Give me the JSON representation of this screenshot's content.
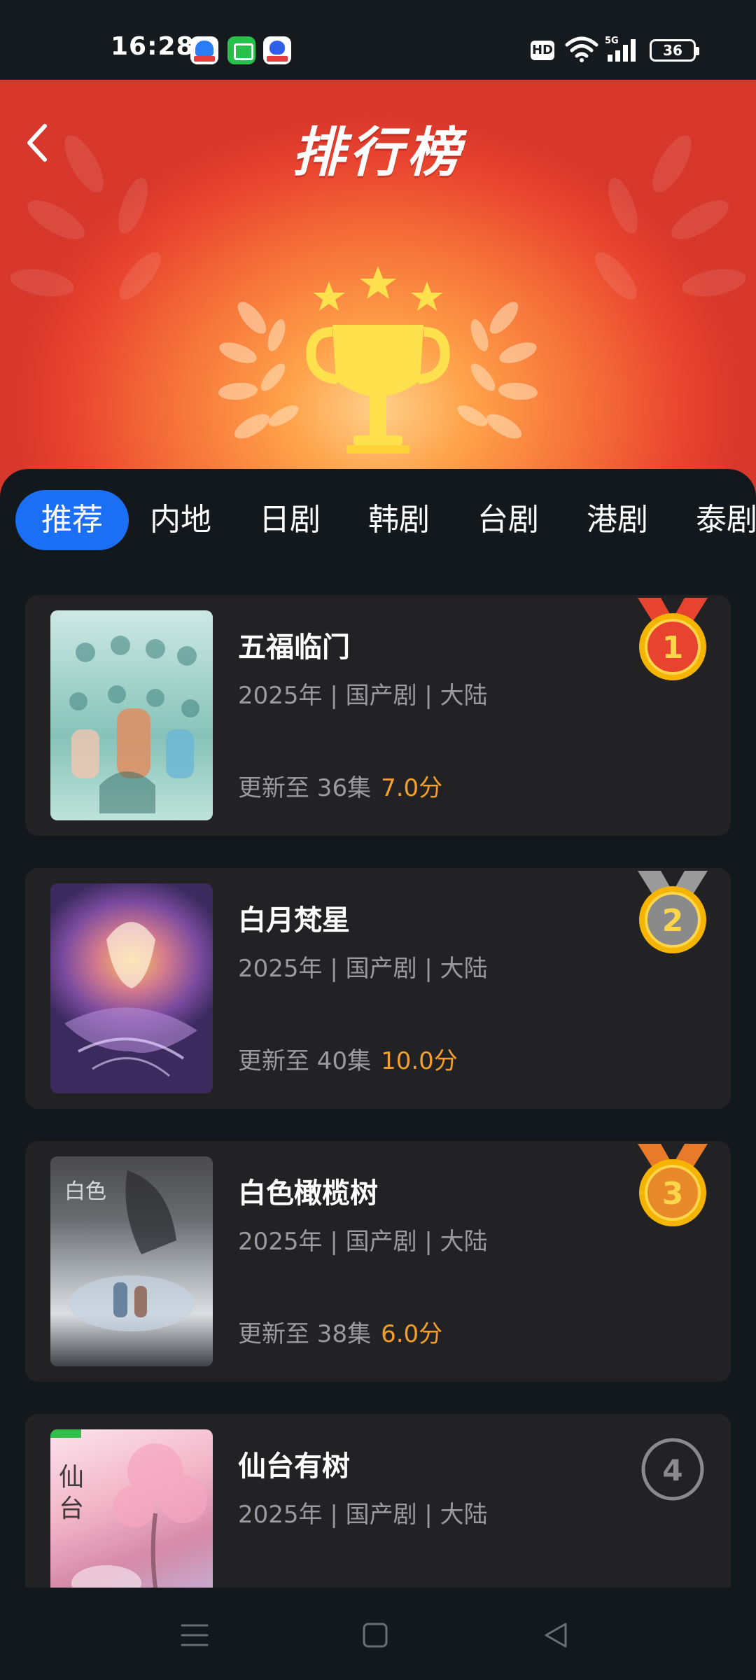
{
  "status_bar": {
    "time": "16:28",
    "network": "HD",
    "signal": "5G",
    "battery": "36"
  },
  "header": {
    "title": "排行榜"
  },
  "tabs": [
    {
      "label": "推荐",
      "active": true
    },
    {
      "label": "内地",
      "active": false
    },
    {
      "label": "日剧",
      "active": false
    },
    {
      "label": "韩剧",
      "active": false
    },
    {
      "label": "台剧",
      "active": false
    },
    {
      "label": "港剧",
      "active": false
    },
    {
      "label": "泰剧",
      "active": false
    }
  ],
  "rankings": [
    {
      "rank": "1",
      "title": "五福临门",
      "meta": "2025年 | 国产剧 | 大陆",
      "update": "更新至 36集",
      "score": "7.0分",
      "medal": "gold"
    },
    {
      "rank": "2",
      "title": "白月梵星",
      "meta": "2025年 | 国产剧 | 大陆",
      "update": "更新至 40集",
      "score": "10.0分",
      "medal": "silver"
    },
    {
      "rank": "3",
      "title": "白色橄榄树",
      "meta": "2025年 | 国产剧 | 大陆",
      "update": "更新至 38集",
      "score": "6.0分",
      "medal": "bronze"
    },
    {
      "rank": "4",
      "title": "仙台有树",
      "meta": "2025年 | 国产剧 | 大陆",
      "update": "",
      "score": "",
      "medal": "plain"
    }
  ],
  "colors": {
    "accent": "#1b6ff5",
    "score": "#f5a02a",
    "card_bg": "#222224",
    "page_bg": "#13181c"
  }
}
